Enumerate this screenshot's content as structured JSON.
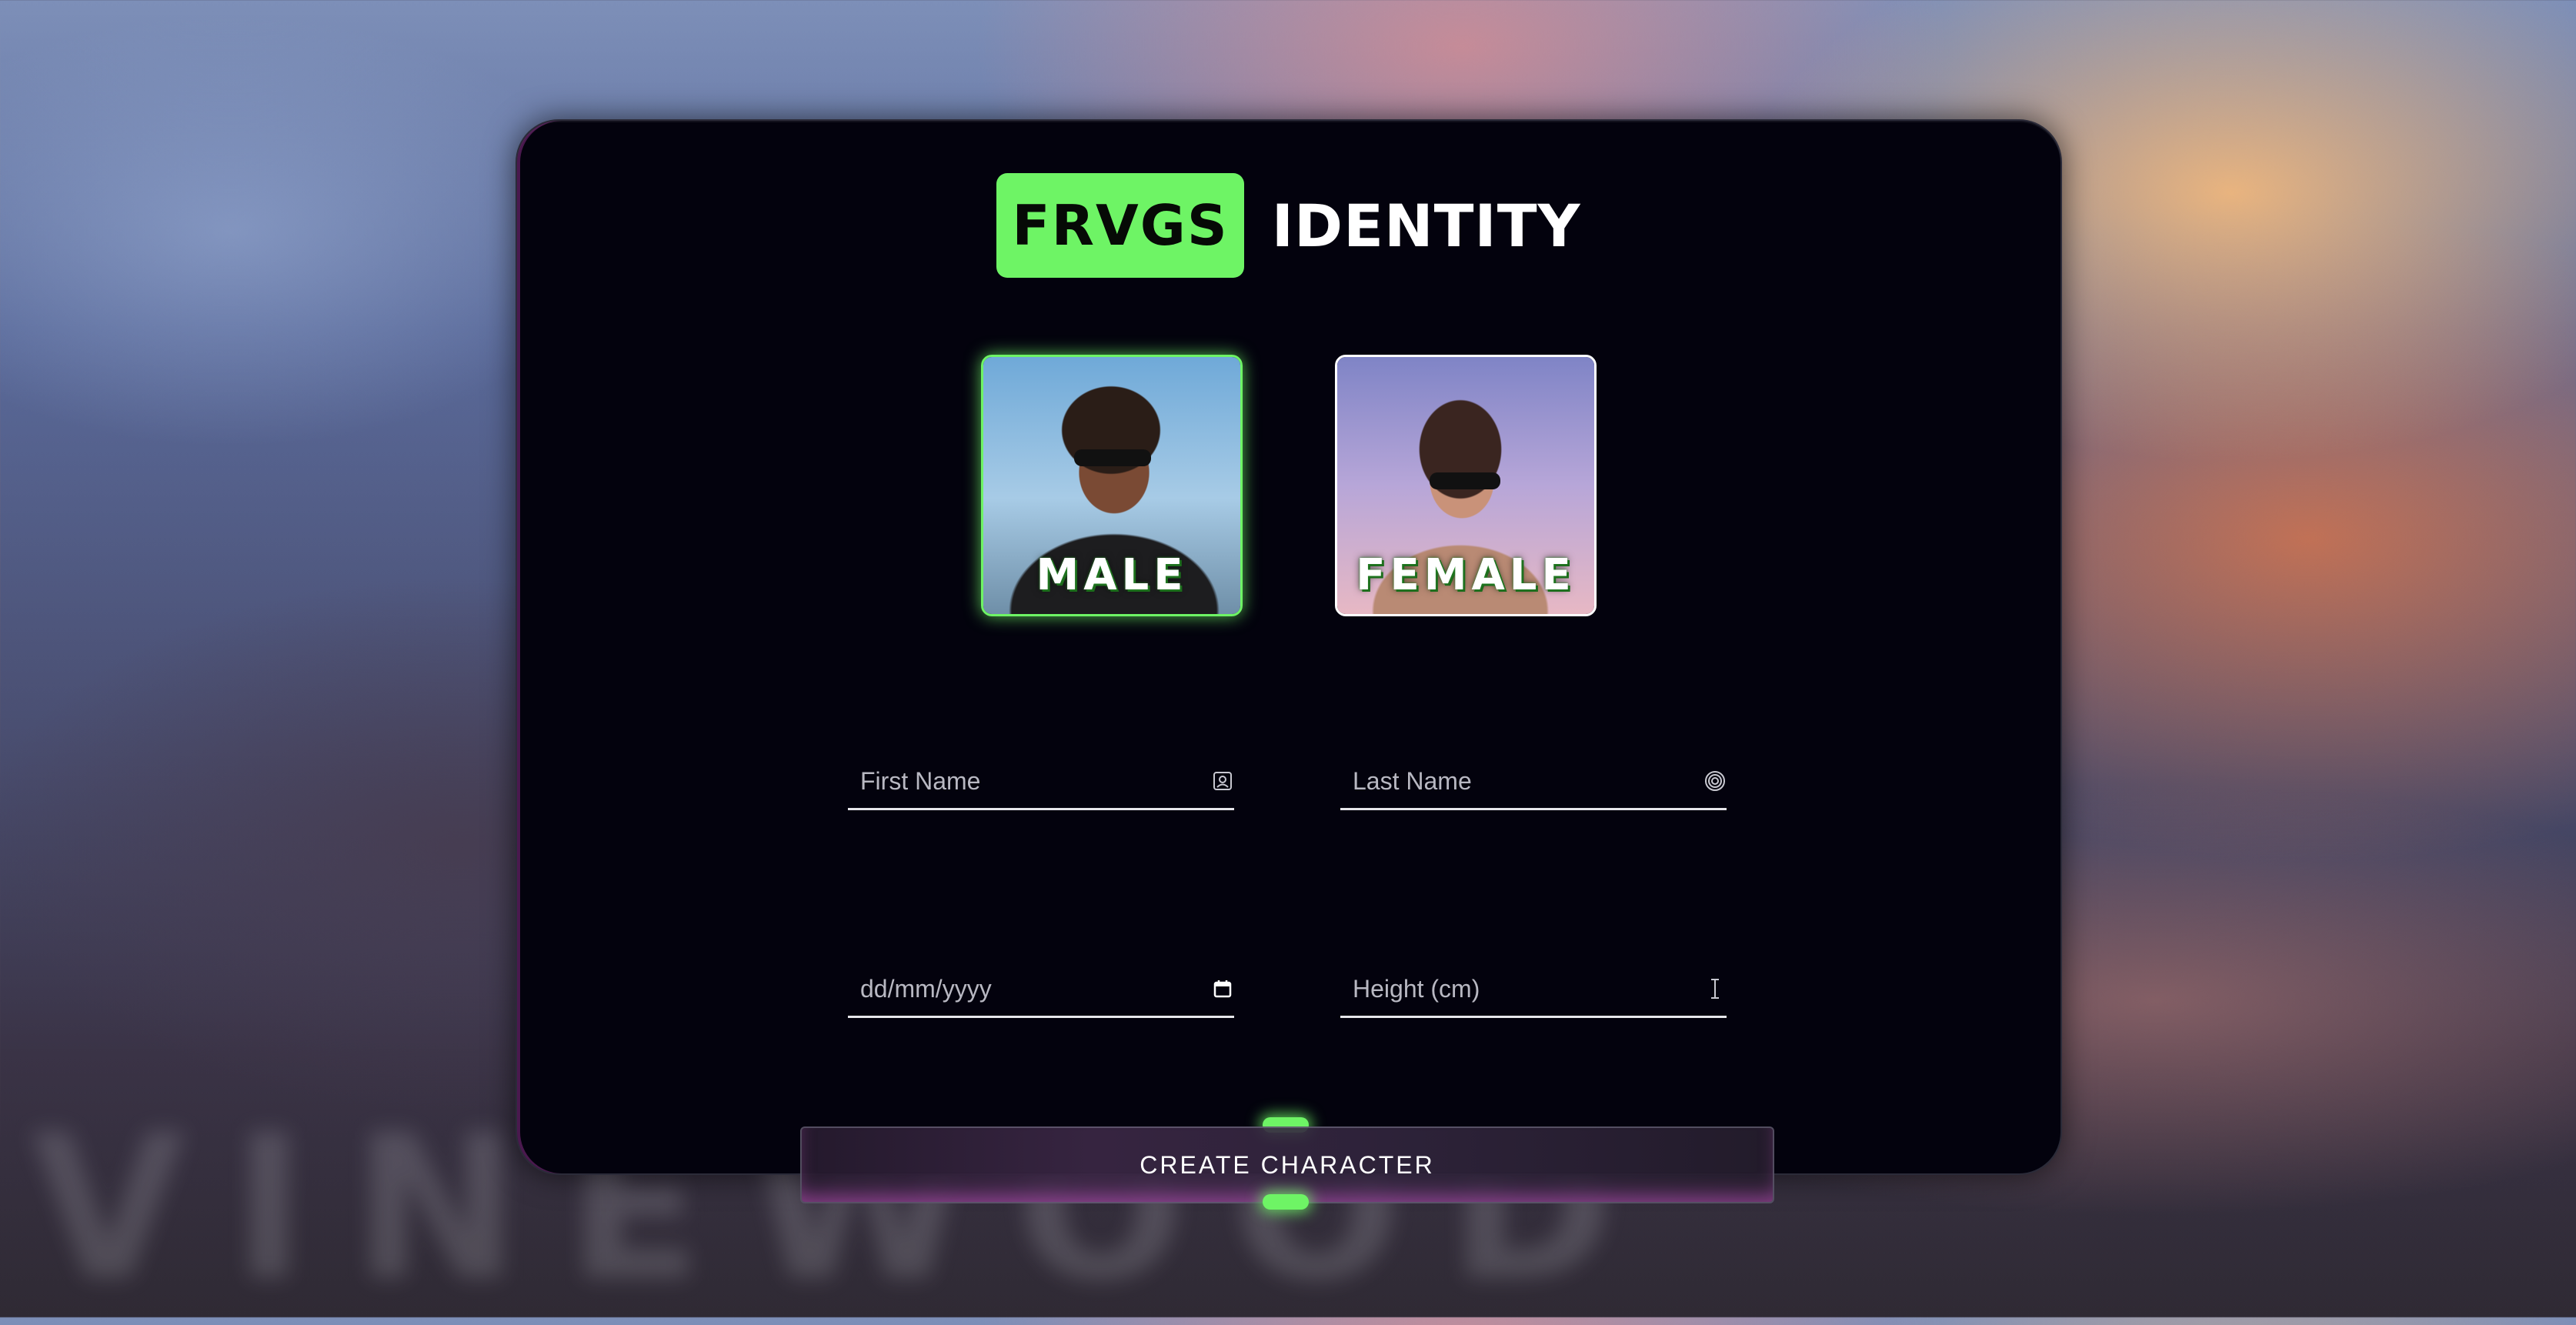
{
  "header": {
    "brand": "FRVGS",
    "title": "IDENTITY"
  },
  "gender": {
    "options": [
      {
        "label": "MALE",
        "selected": true
      },
      {
        "label": "FEMALE",
        "selected": false
      }
    ]
  },
  "form": {
    "first_name_placeholder": "First Name",
    "last_name_placeholder": "Last Name",
    "dob_placeholder": "dd/mm/yyyy",
    "height_placeholder": "Height (cm)"
  },
  "actions": {
    "create_label": "CREATE CHARACTER"
  },
  "colors": {
    "accent": "#6ef465",
    "panel": "#03020d",
    "button_glow": "#d75ad2"
  },
  "icons": {
    "first_name": "id-card-icon",
    "last_name": "fingerprint-icon",
    "dob": "calendar-icon",
    "height": "text-cursor-icon"
  }
}
